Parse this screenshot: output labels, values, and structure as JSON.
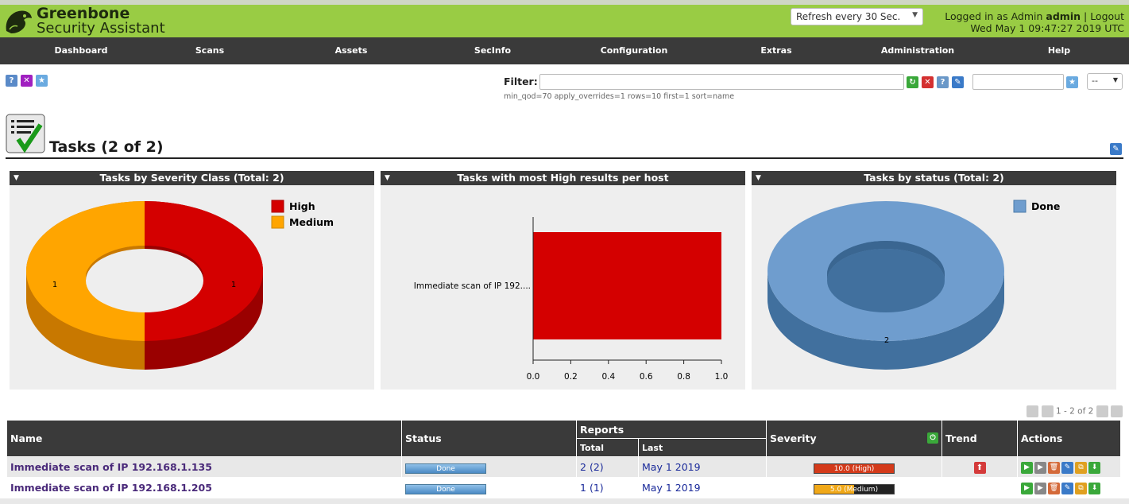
{
  "header": {
    "brand_line1": "Greenbone",
    "brand_line2": "Security Assistant",
    "refresh_value": "Refresh every 30 Sec.",
    "logged_in_prefix": "Logged in as",
    "role": "Admin",
    "user": "admin",
    "logout": "Logout",
    "datetime": "Wed May 1 09:47:27 2019 UTC"
  },
  "nav": [
    "Dashboard",
    "Scans",
    "Assets",
    "SecInfo",
    "Configuration",
    "Extras",
    "Administration",
    "Help"
  ],
  "filter": {
    "label": "Filter:",
    "value": "",
    "text": "min_qod=70 apply_overrides=1 rows=10 first=1 sort=name",
    "select_value": "--"
  },
  "page": {
    "title": "Tasks (2 of 2)"
  },
  "charts": {
    "severity": {
      "title": "Tasks by Severity Class (Total: 2)",
      "legend": [
        {
          "label": "High",
          "color": "#d40000"
        },
        {
          "label": "Medium",
          "color": "#ffa500"
        }
      ]
    },
    "high": {
      "title": "Tasks with most High results per host",
      "bar_label": "Immediate scan of IP 192....",
      "ticks": [
        "0.0",
        "0.2",
        "0.4",
        "0.6",
        "0.8",
        "1.0"
      ]
    },
    "status": {
      "title": "Tasks by status (Total: 2)",
      "legend": [
        {
          "label": "Done",
          "color": "#6f9dce"
        }
      ]
    }
  },
  "chart_data": [
    {
      "type": "pie",
      "title": "Tasks by Severity Class (Total: 2)",
      "categories": [
        "High",
        "Medium"
      ],
      "values": [
        1,
        1
      ],
      "colors": [
        "#d40000",
        "#ffa500"
      ],
      "legend": "top-right"
    },
    {
      "type": "bar",
      "title": "Tasks with most High results per host",
      "categories": [
        "Immediate scan of IP 192...."
      ],
      "values": [
        1.0
      ],
      "xlim": [
        0,
        1.0
      ],
      "orientation": "horizontal",
      "color": "#d40000"
    },
    {
      "type": "pie",
      "title": "Tasks by status (Total: 2)",
      "categories": [
        "Done"
      ],
      "values": [
        2
      ],
      "colors": [
        "#6f9dce"
      ],
      "legend": "top-right"
    }
  ],
  "pager": {
    "text": "1 - 2 of 2"
  },
  "table": {
    "headers": {
      "name": "Name",
      "status": "Status",
      "reports": "Reports",
      "total": "Total",
      "last": "Last",
      "severity": "Severity",
      "trend": "Trend",
      "actions": "Actions"
    },
    "rows": [
      {
        "name": "Immediate scan of IP 192.168.1.135",
        "status": "Done",
        "total": "2",
        "total_sub": "(2)",
        "last": "May 1 2019",
        "severity": "10.0 (High)",
        "severity_fraction": 1.0,
        "severity_color": "#d43a1a"
      },
      {
        "name": "Immediate scan of IP 192.168.1.205",
        "status": "Done",
        "total": "1",
        "total_sub": "(1)",
        "last": "May 1 2019",
        "severity": "5.0 (Medium)",
        "severity_fraction": 0.5,
        "severity_color": "#f0a818"
      }
    ]
  }
}
